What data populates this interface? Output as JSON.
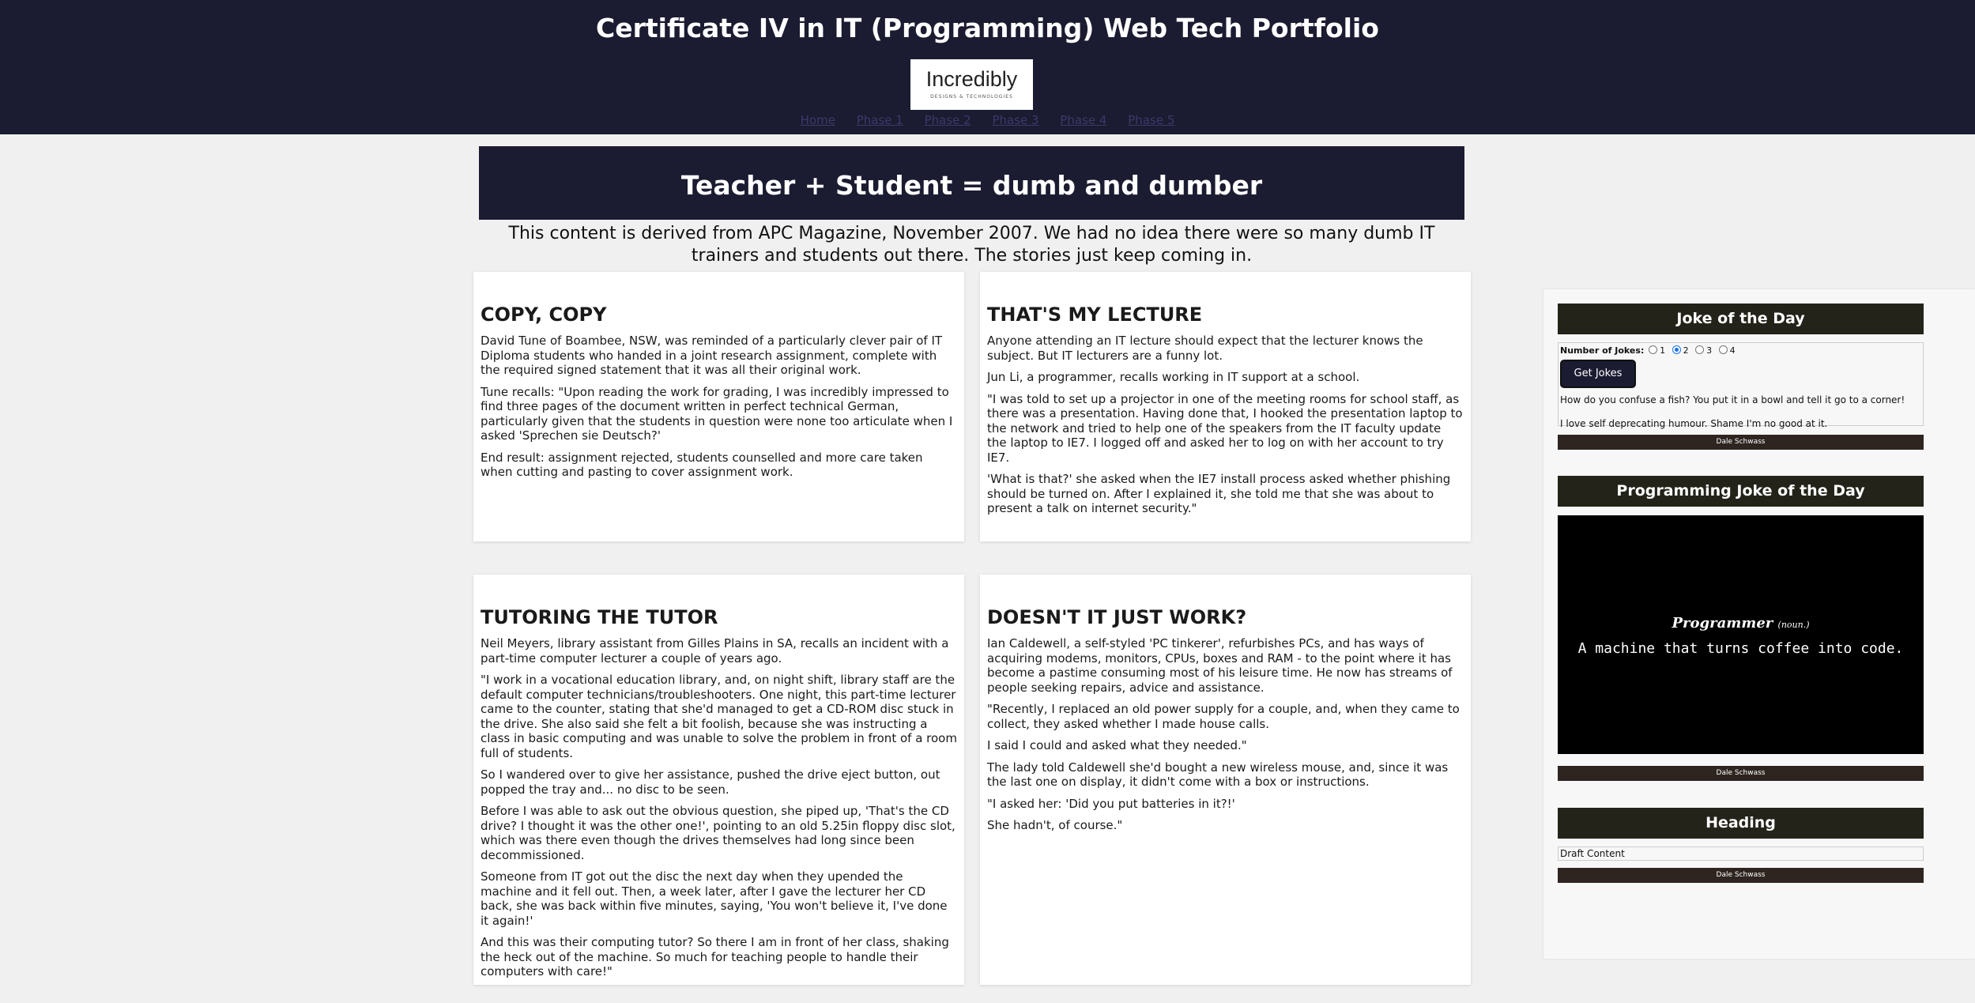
{
  "header": {
    "title": "Certificate IV in IT (Programming) Web Tech Portfolio",
    "logo_text": "Incredibly",
    "logo_subtext": "DESIGNS & TECHNOLOGIES",
    "nav": [
      "Home",
      "Phase 1",
      "Phase 2",
      "Phase 3",
      "Phase 4",
      "Phase 5"
    ]
  },
  "main": {
    "title": "Teacher + Student = dumb and dumber",
    "intro": "This content is derived from APC Magazine, November 2007. We had no idea there were so many dumb IT trainers and students out there. The stories just keep coming in.",
    "cards": [
      {
        "heading": "COPY, COPY",
        "paragraphs": [
          "David Tune of Boambee, NSW, was reminded of a particularly clever pair of IT Diploma students who handed in a joint research assignment, complete with the required signed statement that it was all their original work.",
          "Tune recalls: \"Upon reading the work for grading, I was incredibly impressed to find three pages of the document written in perfect technical German, particularly given that the students in question were none too articulate when I asked 'Sprechen sie Deutsch?'",
          "End result: assignment rejected, students counselled and more care taken when cutting and pasting to cover assignment work."
        ]
      },
      {
        "heading": "THAT'S MY LECTURE",
        "paragraphs": [
          "Anyone attending an IT lecture should expect that the lecturer knows the subject. But IT lecturers are a funny lot.",
          "Jun Li, a programmer, recalls working in IT support at a school.",
          "\"I was told to set up a projector in one of the meeting rooms for school staff, as there was a presentation. Having done that, I hooked the presentation laptop to the network and tried to help one of the speakers from the IT faculty update the laptop to IE7. I logged off and asked her to log on with her account to try IE7.",
          "'What is that?' she asked when the IE7 install process asked whether phishing should be turned on. After I explained it, she told me that she was about to present a talk on internet security.\""
        ]
      },
      {
        "heading": "TUTORING THE TUTOR",
        "paragraphs": [
          "Neil Meyers, library assistant from Gilles Plains in SA, recalls an incident with a part-time computer lecturer a couple of years ago.",
          "\"I work in a vocational education library, and, on night shift, library staff are the default computer technicians/troubleshooters. One night, this part-time lecturer came to the counter, stating that she'd managed to get a CD-ROM disc stuck in the drive. She also said she felt a bit foolish, because she was instructing a class in basic computing and was unable to solve the problem in front of a room full of students.",
          "So I wandered over to give her assistance, pushed the drive eject button, out popped the tray and... no disc to be seen.",
          "Before I was able to ask out the obvious question, she piped up, 'That's the CD drive? I thought it was the other one!', pointing to an old 5.25in floppy disc slot, which was there even though the drives themselves had long since been decommissioned.",
          "Someone from IT got out the disc the next day when they upended the machine and it fell out. Then, a week later, after I gave the lecturer her CD back, she was back within five minutes, saying, 'You won't believe it, I've done it again!'",
          "And this was their computing tutor? So there I am in front of her class, shaking the heck out of the machine. So much for teaching people to handle their computers with care!\""
        ]
      },
      {
        "heading": "DOESN'T IT JUST WORK?",
        "paragraphs": [
          "Ian Caldewell, a self-styled 'PC tinkerer', refurbishes PCs, and has ways of acquiring modems, monitors, CPUs, boxes and RAM - to the point where it has become a pastime consuming most of his leisure time. He now has streams of people seeking repairs, advice and assistance.",
          "\"Recently, I replaced an old power supply for a couple, and, when they came to collect, they asked whether I made house calls.",
          "I said I could and asked what they needed.\"",
          "The lady told Caldewell she'd bought a new wireless mouse, and, since it was the last one on display, it didn't come with a box or instructions.",
          "\"I asked her: 'Did you put batteries in it?!'",
          "She hadn't, of course.\""
        ]
      }
    ]
  },
  "sidebar": {
    "joke_widget": {
      "heading": "Joke of the Day",
      "count_label": "Number of Jokes:",
      "options": [
        "1",
        "2",
        "3",
        "4"
      ],
      "selected": "2",
      "button_label": "Get Jokes",
      "jokes": [
        "How do you confuse a fish? You put it in a bowl and tell it go to a corner!",
        "I love self deprecating humour. Shame I'm no good at it."
      ],
      "footer": "Dale Schwass"
    },
    "prog_widget": {
      "heading": "Programming Joke of the Day",
      "word": "Programmer",
      "word_type": "(noun.)",
      "definition": "A machine that turns coffee into code.",
      "footer": "Dale Schwass"
    },
    "draft_widget": {
      "heading": "Heading",
      "content": "Draft Content",
      "footer": "Dale Schwass"
    }
  }
}
